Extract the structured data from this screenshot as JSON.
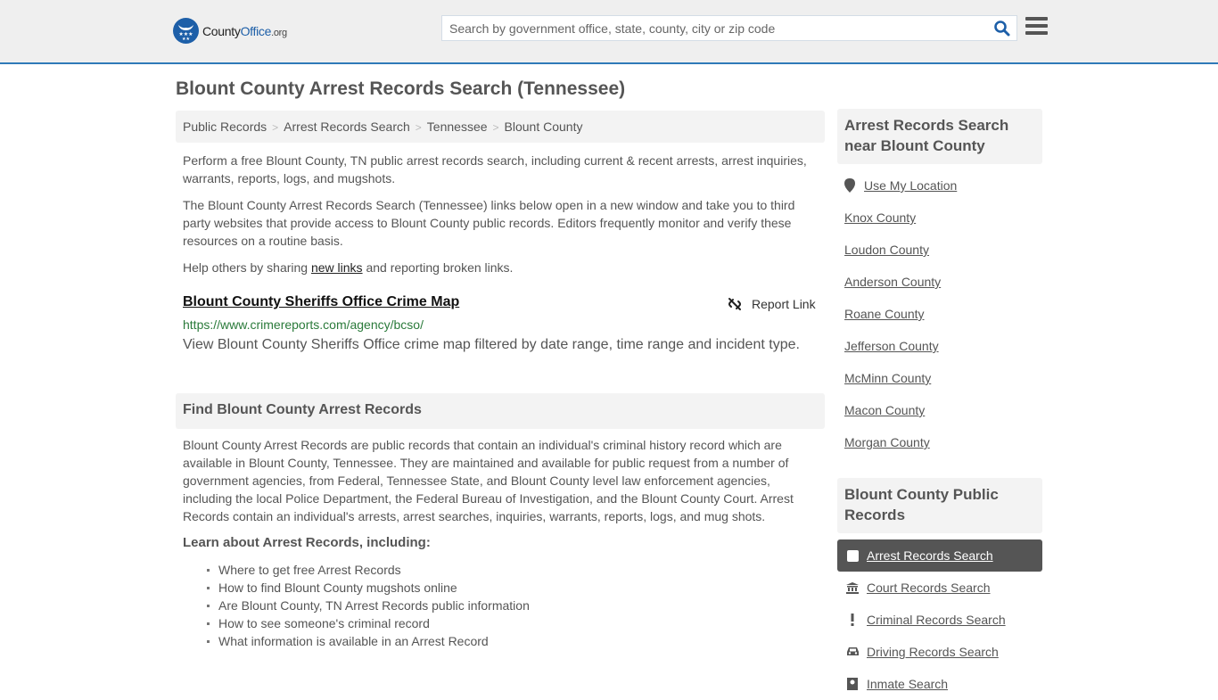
{
  "header": {
    "logo": {
      "part1": "County",
      "part2": "Office",
      "part3": ".org"
    },
    "search_placeholder": "Search by government office, state, county, city or zip code",
    "search_value": "",
    "icons": {
      "search": "search-icon",
      "menu": "hamburger-menu-icon"
    },
    "accent_color": "#2f7ab8"
  },
  "page": {
    "title": "Blount County Arrest Records Search (Tennessee)"
  },
  "breadcrumb": [
    {
      "label": "Public Records"
    },
    {
      "label": "Arrest Records Search"
    },
    {
      "label": "Tennessee"
    },
    {
      "label": "Blount County"
    }
  ],
  "intro": {
    "p1": "Perform a free Blount County, TN public arrest records search, including current & recent arrests, arrest inquiries, warrants, reports, logs, and mugshots.",
    "p2": "The Blount County Arrest Records Search (Tennessee) links below open in a new window and take you to third party websites that provide access to Blount County public records. Editors frequently monitor and verify these resources on a routine basis.",
    "p3_before": "Help others by sharing ",
    "p3_link": "new links",
    "p3_after": " and reporting broken links."
  },
  "result": {
    "title": "Blount County Sheriffs Office Crime Map",
    "url": "https://www.crimereports.com/agency/bcso/",
    "description": "View Blount County Sheriffs Office crime map filtered by date range, time range and incident type.",
    "report_label": "Report Link",
    "url_color": "#2a7a3a"
  },
  "find_section": {
    "heading": "Find Blount County Arrest Records",
    "body": "Blount County Arrest Records are public records that contain an individual's criminal history record which are available in Blount County, Tennessee. They are maintained and available for public request from a number of government agencies, from Federal, Tennessee State, and Blount County level law enforcement agencies, including the local Police Department, the Federal Bureau of Investigation, and the Blount County Court. Arrest Records contain an individual's arrests, arrest searches, inquiries, warrants, reports, logs, and mug shots.",
    "learn_title": "Learn about Arrest Records, including:",
    "learn_items": [
      "Where to get free Arrest Records",
      "How to find Blount County mugshots online",
      "Are Blount County, TN Arrest Records public information",
      "How to see someone's criminal record",
      "What information is available in an Arrest Record"
    ]
  },
  "sidebar": {
    "nearby_heading": "Arrest Records Search near Blount County",
    "use_location": "Use My Location",
    "nearby": [
      "Knox County",
      "Loudon County",
      "Anderson County",
      "Roane County",
      "Jefferson County",
      "McMinn County",
      "Macon County",
      "Morgan County"
    ],
    "public_records_heading": "Blount County Public Records",
    "public_records": [
      {
        "label": "Arrest Records Search",
        "icon": "square-icon",
        "active": true
      },
      {
        "label": "Court Records Search",
        "icon": "courthouse-icon",
        "active": false
      },
      {
        "label": "Criminal Records Search",
        "icon": "exclamation-icon",
        "active": false
      },
      {
        "label": "Driving Records Search",
        "icon": "car-icon",
        "active": false
      },
      {
        "label": "Inmate Search",
        "icon": "inmate-icon",
        "active": false
      }
    ]
  }
}
